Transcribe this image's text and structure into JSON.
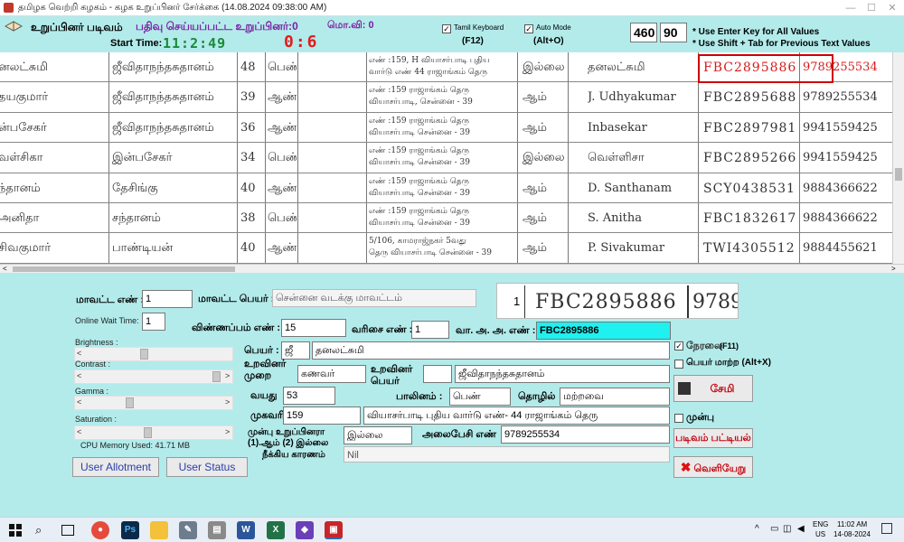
{
  "window": {
    "title": "தமிழக வெற்றி கழகம் - கழக உறுப்பினர் சேர்க்கை (14.08.2024 09:38:00 AM)",
    "minimize": "—",
    "maximize": "☐",
    "close": "✕"
  },
  "header": {
    "form_title": "உறுப்பினர் படிவம்",
    "registered_label": "பதிவு செய்யப்பட்ட உறுப்பினர்:0",
    "mo_vi_label": "மொ.வி: 0",
    "start_time_label": "Start Time:",
    "start_time": "11:2:49",
    "counter": "0:6",
    "tamil_keyboard_label": "Tamil Keyboard",
    "tamil_keyboard_key": "(F12)",
    "auto_mode_label": "Auto Mode",
    "auto_mode_key": "(Alt+O)",
    "value_1": "460",
    "value_2": "90",
    "hint_1": "* Use Enter Key for All Values",
    "hint_2": "* Use Shift + Tab for Previous Text Values"
  },
  "scan_rows": [
    {
      "name": "னலட்சுமி",
      "father": "ஜீவிதாநந்தசுதானம்",
      "age": "48",
      "gender": "பெண்",
      "addr1": "எண் :159, H வியாசர்பாடி புதிய",
      "addr2": "வார்டு எண் 44 ராஜாங்கம் தெரு",
      "status": "இல்லை",
      "sign": "தனலட்சுமி",
      "id": "FBC2895886",
      "phone": "9789255534"
    },
    {
      "name": "தயகுமார்",
      "father": "ஜீவிதாநந்தசுதானம்",
      "age": "39",
      "gender": "ஆண்",
      "addr1": "எண் :159 ராஜாங்கம் தெரு",
      "addr2": "வியாசர்பாடி, சென்னை - 39",
      "status": "ஆம்",
      "sign": "J. Udhyakumar",
      "id": "FBC2895688",
      "phone": "9789255534"
    },
    {
      "name": "ன்பசேகர்",
      "father": "ஜீவிதாநந்தசுதானம்",
      "age": "36",
      "gender": "ஆண்",
      "addr1": "எண் :159 ராஜாங்கம் தெரு",
      "addr2": "வியாசர்பாடி சென்னை - 39",
      "status": "ஆம்",
      "sign": "Inbasekar",
      "id": "FBC2897981",
      "phone": "9941559425"
    },
    {
      "name": "வள்சிகா",
      "father": "இன்பசேகர்",
      "age": "34",
      "gender": "பெண்",
      "addr1": "எண் :159 ராஜாங்கம் தெரு",
      "addr2": "வியாசர்பாடி சென்னை - 39",
      "status": "இல்லை",
      "sign": "வெள்ளிசா",
      "id": "FBC2895266",
      "phone": "9941559425"
    },
    {
      "name": "ந்தானம்",
      "father": "தேசிங்கு",
      "age": "40",
      "gender": "ஆண்",
      "addr1": "எண் :159 ராஜாங்கம் தெரு",
      "addr2": "வியாசர்பாடி சென்னை - 39",
      "status": "ஆம்",
      "sign": "D. Santhanam",
      "id": "SCY0438531",
      "phone": "9884366622"
    },
    {
      "name": "அனிதா",
      "father": "சந்தானம்",
      "age": "38",
      "gender": "பெண்",
      "addr1": "எண் :159 ராஜாங்கம் தெரு",
      "addr2": "வியாசர்பாடி சென்னை - 39",
      "status": "ஆம்",
      "sign": "S. Anitha",
      "id": "FBC1832617",
      "phone": "9884366622"
    },
    {
      "name": "சிவகுமார்",
      "father": "பாண்டியன்",
      "age": "40",
      "gender": "ஆண்",
      "addr1": "5/106, காமராஜ்நகர் 5வது",
      "addr2": "தெரு வியாசர்பாடி சென்னை - 39",
      "status": "ஆம்",
      "sign": "P. Sivakumar",
      "id": "TWI4305512",
      "phone": "9884455621"
    }
  ],
  "form": {
    "district_no_label": "மாவட்ட எண் :",
    "district_no": "1",
    "district_name_label": "மாவட்ட பெயர் :",
    "district_name": "சென்னை வடக்கு மாவட்டம்",
    "online_wait_label": "Online Wait Time:",
    "online_wait": "1",
    "application_no_label": "விண்ணப்பம் எண் :",
    "application_no": "15",
    "serial_no_label": "வரிசை எண் :",
    "serial_no": "1",
    "voter_id_label": "வா. அ. அ. எண் :",
    "voter_id": "FBC2895886",
    "preview_serial": "1",
    "preview_id": "FBC2895886",
    "preview_phone": "9789",
    "brightness_label": "Brightness :",
    "contrast_label": "Contrast :",
    "gamma_label": "Gamma :",
    "saturation_label": "Saturation :",
    "slider_left": "<",
    "slider_right": ">",
    "cpu_memory": "CPU Memory Used: 41.71 MB",
    "name_label": "பெயர் :",
    "name_initial": "ஜீ",
    "name": "தனலட்சுமி",
    "relation_label": "உறவினர் முறை",
    "relation": "கணவர்",
    "relative_name_label": "உறவினர் பெயர்",
    "relative_initial": "",
    "relative_name": "ஜீவிதாநந்தசுதானம்",
    "age_label": "வயது",
    "age": "53",
    "gender_label": "பாலினம் :",
    "gender": "பெண்",
    "occupation_label": "தொழில்",
    "occupation": "மற்றவை",
    "address_label": "முகவரி",
    "address_no": "159",
    "address": "வியாசர்பாடி புதிய வார்டு எண்- 44 ராஜாங்கம் தெரு",
    "prev_member_label": "முன்பு உறுப்பினரா (1).ஆம் (2) இல்லை",
    "prev_member": "இல்லை",
    "mobile_label": "அலைபேசி எண்",
    "mobile": "9789255534",
    "removed_reason_label": "நீக்கிய காரணம்",
    "removed_reason": "Nil",
    "direct_label": "நேரலை",
    "direct_key": "(F11)",
    "name_change_label": "பெயர் மாற்ற (Alt+X)",
    "save_label": "சேமி",
    "previous_label": "முன்பு",
    "form_list_label": "படிவம் பட்டியல்",
    "exit_label": "வெளியேறு",
    "user_allotment_label": "User Allotment",
    "user_status_label": "User Status"
  },
  "taskbar": {
    "lang_1": "ENG",
    "lang_2": "US",
    "time": "11:02 AM",
    "date": "14-08-2024",
    "apps": [
      "windows-icon",
      "search-icon",
      "task-view-icon",
      "chrome-icon",
      "photoshop-icon",
      "file-explorer-icon",
      "tools-icon",
      "printer-icon",
      "word-icon",
      "excel-icon",
      "visual-studio-icon",
      "app-icon"
    ]
  },
  "colors": {
    "background": "#b3ebeb",
    "highlight": "#1ff0f0",
    "timer_green": "#1b8a3a",
    "timer_red": "#e21c1c",
    "header_purple": "#7a1fa2",
    "button_blue": "#2a3ea8",
    "button_red": "#c0000a"
  }
}
